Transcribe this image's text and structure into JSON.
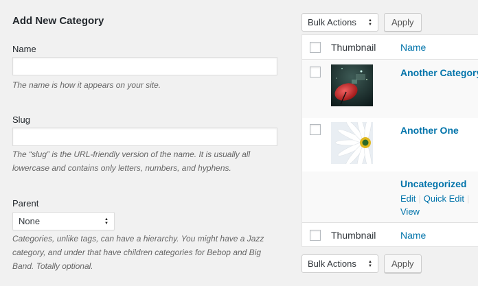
{
  "form": {
    "title": "Add New Category",
    "name_label": "Name",
    "name_value": "",
    "name_desc": "The name is how it appears on your site.",
    "slug_label": "Slug",
    "slug_value": "",
    "slug_desc_line1": "The “slug” is the URL-friendly version of the name. It is usually all",
    "slug_desc_line2": "lowercase and contains only letters, numbers, and hyphens.",
    "parent_label": "Parent",
    "parent_selected": "None",
    "parent_desc_line1": "Categories, unlike tags, can have a hierarchy. You might have a Jazz",
    "parent_desc_line2": "category, and under that have children categories for Bebop and Big",
    "parent_desc_line3": "Band. Totally optional."
  },
  "bulk": {
    "actions_label": "Bulk Actions",
    "apply_label": "Apply"
  },
  "table": {
    "col_thumbnail": "Thumbnail",
    "col_name": "Name",
    "rows": [
      {
        "name": "Another Category",
        "thumbnail": "red-umbrella-night-photo"
      },
      {
        "name": "Another One",
        "thumbnail": "white-daisy-photo"
      },
      {
        "name": "Uncategorized",
        "thumbnail": ""
      }
    ],
    "row_actions": {
      "edit": "Edit",
      "quick_edit": "Quick Edit",
      "view": "View"
    }
  },
  "colors": {
    "link": "#0073aa",
    "page_bg": "#f1f1f1",
    "row_alt": "#f9f9f9"
  }
}
